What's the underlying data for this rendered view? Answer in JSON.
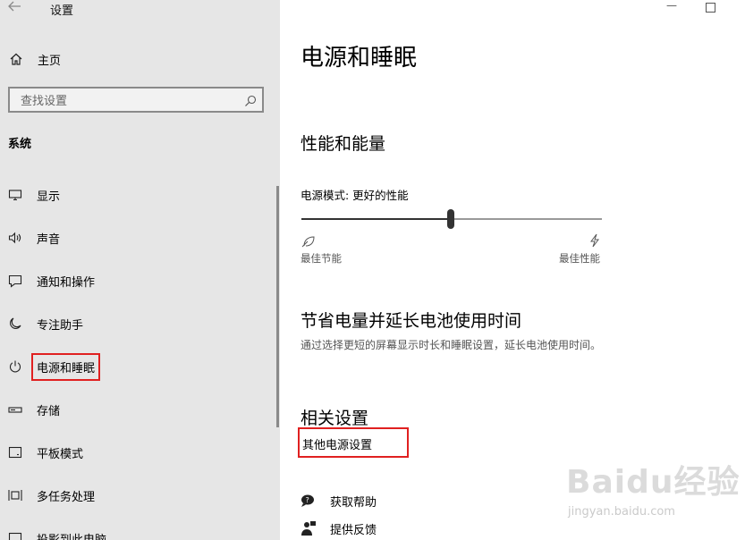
{
  "app": {
    "title": "设置"
  },
  "sidebar": {
    "home_label": "主页",
    "search_placeholder": "查找设置",
    "section_label": "系统",
    "items": [
      {
        "label": "显示",
        "icon": "monitor-icon"
      },
      {
        "label": "声音",
        "icon": "speaker-icon"
      },
      {
        "label": "通知和操作",
        "icon": "notification-icon"
      },
      {
        "label": "专注助手",
        "icon": "moon-icon"
      },
      {
        "label": "电源和睡眠",
        "icon": "power-icon",
        "selected": true
      },
      {
        "label": "存储",
        "icon": "storage-icon"
      },
      {
        "label": "平板模式",
        "icon": "tablet-icon"
      },
      {
        "label": "多任务处理",
        "icon": "multitask-icon"
      },
      {
        "label": "投影到此电脑",
        "icon": "project-icon"
      }
    ]
  },
  "main": {
    "title": "电源和睡眠",
    "performance": {
      "heading": "性能和能量",
      "mode_label": "电源模式: 更好的性能",
      "slider_value": 0.5,
      "slider_min_label": "最佳节能",
      "slider_max_label": "最佳性能"
    },
    "battery": {
      "heading": "节省电量并延长电池使用时间",
      "description": "通过选择更短的屏幕显示时长和睡眠设置，延长电池使用时间。"
    },
    "related": {
      "heading": "相关设置",
      "link": "其他电源设置"
    },
    "help": [
      {
        "label": "获取帮助",
        "icon": "help-chat-icon"
      },
      {
        "label": "提供反馈",
        "icon": "feedback-icon"
      }
    ]
  },
  "watermark": {
    "text": "Baidu经验",
    "sub": "jingyan.baidu.com"
  },
  "colors": {
    "sidebar_bg": "#e6e6e6",
    "highlight": "#e02020",
    "accent": "#333333"
  }
}
